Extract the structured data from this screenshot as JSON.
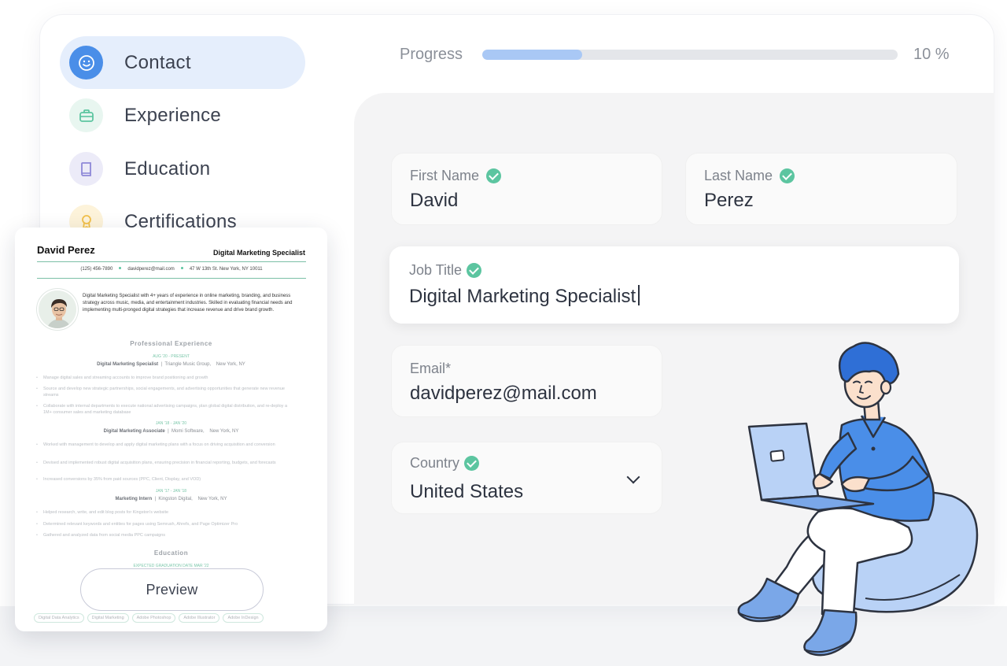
{
  "sidebar": {
    "items": [
      {
        "label": "Contact",
        "icon": "smiley-icon",
        "active": true,
        "color": "#4a8ee8"
      },
      {
        "label": "Experience",
        "icon": "briefcase-icon",
        "active": false,
        "color": "#5cc5a0"
      },
      {
        "label": "Education",
        "icon": "book-icon",
        "active": false,
        "color": "#8e88d8"
      },
      {
        "label": "Certifications",
        "icon": "ribbon-icon",
        "active": false,
        "color": "#f2c04a"
      }
    ]
  },
  "progress": {
    "label": "Progress",
    "value": 10,
    "text": "10 %",
    "fill_color": "#a9c8f5"
  },
  "form": {
    "first_name": {
      "label": "First Name",
      "value": "David",
      "verified": true
    },
    "last_name": {
      "label": "Last Name",
      "value": "Perez",
      "verified": true
    },
    "job_title": {
      "label": "Job Title",
      "value": "Digital Marketing Specialist",
      "verified": true
    },
    "email": {
      "label": "Email*",
      "value": "davidperez@mail.com"
    },
    "country": {
      "label": "Country",
      "value": "United States",
      "verified": true
    }
  },
  "resume": {
    "name": "David Perez",
    "title": "Digital Marketing Specialist",
    "phone": "(125) 456-7890",
    "email": "davidperez@mail.com",
    "address": "47 W 13th St. New York, NY 10011",
    "summary": "Digital Marketing Specialist with 4+ years of experience in online marketing, branding, and business strategy across music, media, and entertainment industries. Skilled in evaluating financial needs and implementing multi-pronged digital strategies that increase revenue and drive brand growth.",
    "experience_heading": "Professional Experience",
    "jobs": [
      {
        "dates": "AUG '20 - PRESENT",
        "role": "Digital Marketing Specialist",
        "company": "Triangle Music Group,",
        "location": "New York, NY",
        "bullets": [
          "Manage digital sales and streaming accounts to improve brand positioning and growth",
          "Source and develop new strategic partnerships, social engagements, and advertising opportunities that generate new revenue streams",
          "Collaborate with internal departments to execute national advertising campaigns, plan global digital distribution, and re-deploy a 1M+ consumer sales and marketing database"
        ]
      },
      {
        "dates": "JAN '18 - JAN '20",
        "role": "Digital Marketing Associate",
        "company": "Momi Software,",
        "location": "New York, NY",
        "bullets": [
          "Worked with management to develop and apply digital marketing plans with a focus on driving acquisition and conversion",
          "Devised and implemented robust digital acquisition plans, ensuring precision in financial reporting, budgets, and forecasts",
          "Increased conversions by 35% from paid sources (PPC, Client, Display, and VOD)"
        ]
      },
      {
        "dates": "JAN '17 - JAN '18",
        "role": "Marketing Intern",
        "company": "Kingston Digital,",
        "location": "New York, NY",
        "bullets": [
          "Helped research, write, and edit blog posts for Kingston's website",
          "Determined relevant keywords and entities for pages using Semrush, Ahrefs, and Page Optimizer Pro",
          "Gathered and analyzed data from social media PPC campaigns"
        ]
      }
    ],
    "education_heading": "Education",
    "education_date": "EXPECTED GRADUATION DATE MAR '22",
    "skills": [
      "Digital Data Analytics",
      "Digital Marketing",
      "Adobe Photoshop",
      "Adobe Illustrator",
      "Adobe InDesign"
    ],
    "preview_label": "Preview"
  }
}
